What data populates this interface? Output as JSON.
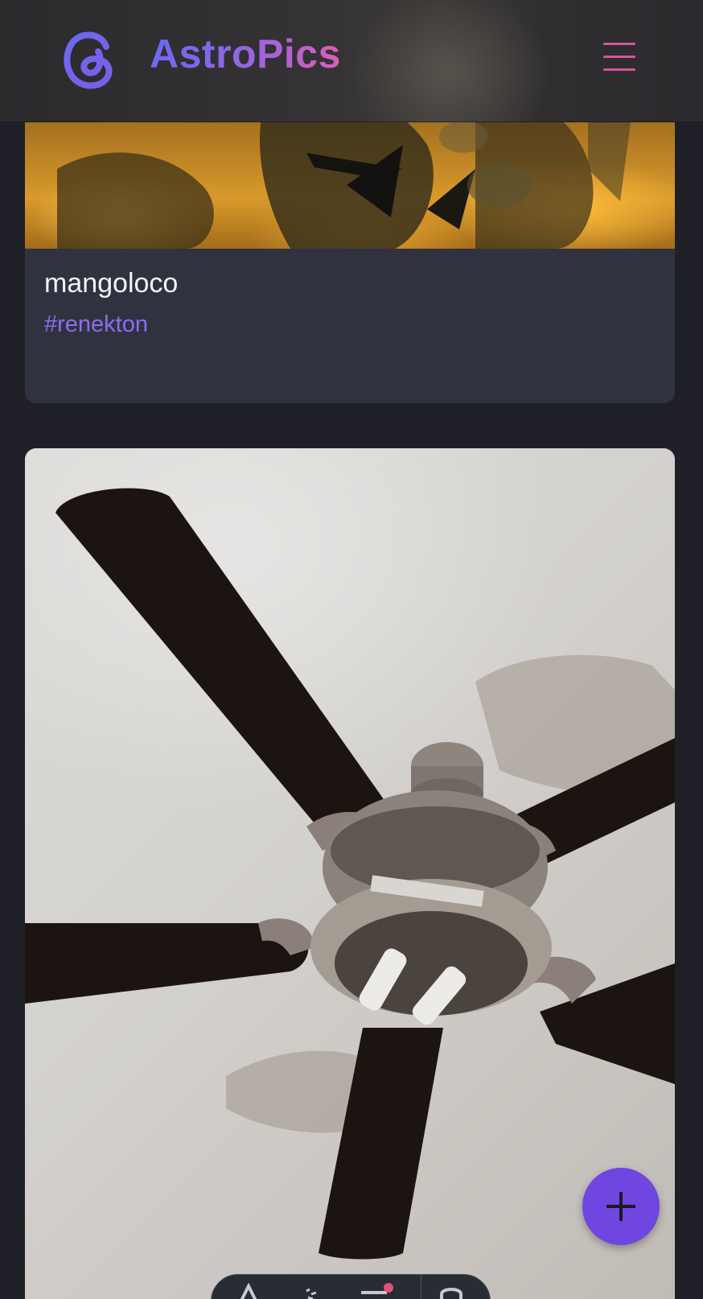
{
  "app": {
    "brand_name": "AstroPics",
    "logo_icon": "threads-logo-icon",
    "menu_icon": "hamburger-menu-icon"
  },
  "colors": {
    "page_background": "#1f2027",
    "card_background": "#30333f",
    "brand_gradient_start": "#6a6af0",
    "brand_gradient_end": "#d85fb8",
    "hashtag": "#8c6cf0",
    "menu_icon": "#d5569f",
    "fab_background": "#6f46e0"
  },
  "feed": {
    "posts": [
      {
        "author": "mangoloco",
        "tag": "#renekton",
        "image_icon": "fiery-claw-artwork"
      },
      {
        "image_icon": "ceiling-fan-photo"
      }
    ]
  },
  "fab": {
    "icon": "plus-icon"
  },
  "dock": {
    "items": [
      {
        "icon": "home-icon"
      },
      {
        "icon": "sparkle-icon"
      },
      {
        "icon": "notifications-icon",
        "has_badge": true
      },
      {
        "icon": "profile-icon"
      }
    ]
  }
}
